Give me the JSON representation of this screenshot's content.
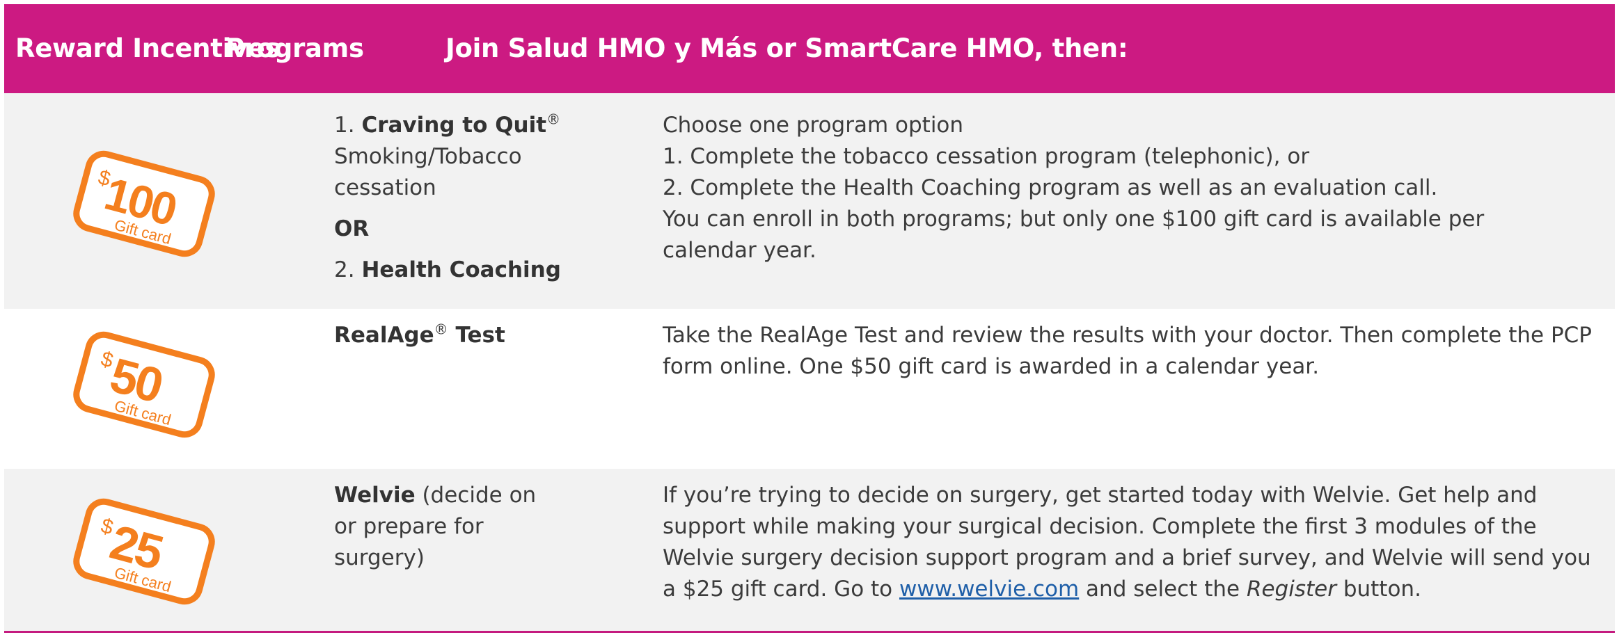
{
  "header": {
    "col1": "Reward Incentives",
    "col2": "Programs",
    "col3": "Join Salud HMO y Más or SmartCare HMO, then:"
  },
  "colors": {
    "header_bg": "#cc1a82",
    "card_orange": "#f47f1e",
    "row_shade": "#f2f2f2",
    "link": "#1f5fa8"
  },
  "rows": [
    {
      "card": {
        "currency": "$",
        "amount": "100",
        "caption": "Gift card",
        "icon": "gift-card-100-icon"
      },
      "program": {
        "item1_number": "1.",
        "item1_name": "Craving to Quit",
        "item1_mark": "®",
        "item1_desc": "Smoking/Tobacco cessation",
        "or": "OR",
        "item2_number": "2.",
        "item2_name": "Health Coaching"
      },
      "description": {
        "line1": "Choose one program option",
        "line2": "1. Complete the tobacco cessation program (telephonic), or",
        "line3": "2. Complete  the Health Coaching program as well as an evaluation call.",
        "line4": "You can enroll in both programs; but only one $100 gift card is available per calendar year."
      }
    },
    {
      "card": {
        "currency": "$",
        "amount": "50",
        "caption": "Gift card",
        "icon": "gift-card-50-icon"
      },
      "program": {
        "name": "RealAge",
        "mark": "®",
        "suffix": " Test"
      },
      "description": {
        "text": "Take the RealAge Test and review the results with your doctor. Then complete the PCP form online. One $50 gift card is awarded in a calendar year."
      }
    },
    {
      "card": {
        "currency": "$",
        "amount": "25",
        "caption": "Gift card",
        "icon": "gift-card-25-icon"
      },
      "program": {
        "name": "Welvie",
        "desc": " (decide on or prepare for surgery)"
      },
      "description": {
        "before_link": "If you’re trying to decide on surgery, get started today with Welvie. Get help and support while making your surgical decision. Complete the first 3 modules of the Welvie surgery decision support program and a brief survey, and Welvie will send you a $25 gift card. Go to ",
        "link": "www.welvie.com",
        "middle": " and select the ",
        "emph": "Register",
        "after": " button."
      }
    }
  ]
}
